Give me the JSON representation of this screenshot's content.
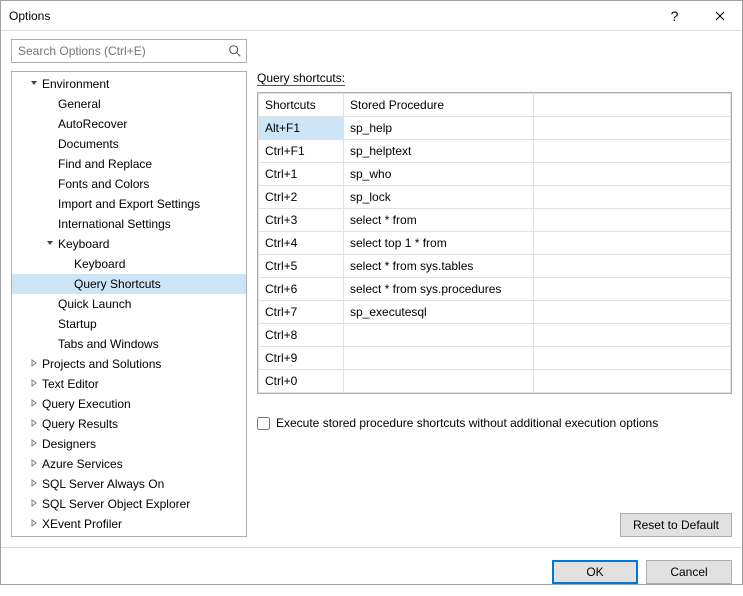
{
  "window": {
    "title": "Options"
  },
  "search": {
    "placeholder": "Search Options (Ctrl+E)"
  },
  "tree": {
    "items": [
      {
        "label": "Environment",
        "indent": 1,
        "arrow": "down",
        "selected": false
      },
      {
        "label": "General",
        "indent": 2,
        "arrow": "none",
        "selected": false
      },
      {
        "label": "AutoRecover",
        "indent": 2,
        "arrow": "none",
        "selected": false
      },
      {
        "label": "Documents",
        "indent": 2,
        "arrow": "none",
        "selected": false
      },
      {
        "label": "Find and Replace",
        "indent": 2,
        "arrow": "none",
        "selected": false
      },
      {
        "label": "Fonts and Colors",
        "indent": 2,
        "arrow": "none",
        "selected": false
      },
      {
        "label": "Import and Export Settings",
        "indent": 2,
        "arrow": "none",
        "selected": false
      },
      {
        "label": "International Settings",
        "indent": 2,
        "arrow": "none",
        "selected": false
      },
      {
        "label": "Keyboard",
        "indent": 2,
        "arrow": "down",
        "selected": false
      },
      {
        "label": "Keyboard",
        "indent": 3,
        "arrow": "none",
        "selected": false
      },
      {
        "label": "Query Shortcuts",
        "indent": 3,
        "arrow": "none",
        "selected": true
      },
      {
        "label": "Quick Launch",
        "indent": 2,
        "arrow": "none",
        "selected": false
      },
      {
        "label": "Startup",
        "indent": 2,
        "arrow": "none",
        "selected": false
      },
      {
        "label": "Tabs and Windows",
        "indent": 2,
        "arrow": "none",
        "selected": false
      },
      {
        "label": "Projects and Solutions",
        "indent": 1,
        "arrow": "right",
        "selected": false
      },
      {
        "label": "Text Editor",
        "indent": 1,
        "arrow": "right",
        "selected": false
      },
      {
        "label": "Query Execution",
        "indent": 1,
        "arrow": "right",
        "selected": false
      },
      {
        "label": "Query Results",
        "indent": 1,
        "arrow": "right",
        "selected": false
      },
      {
        "label": "Designers",
        "indent": 1,
        "arrow": "right",
        "selected": false
      },
      {
        "label": "Azure Services",
        "indent": 1,
        "arrow": "right",
        "selected": false
      },
      {
        "label": "SQL Server Always On",
        "indent": 1,
        "arrow": "right",
        "selected": false
      },
      {
        "label": "SQL Server Object Explorer",
        "indent": 1,
        "arrow": "right",
        "selected": false
      },
      {
        "label": "XEvent Profiler",
        "indent": 1,
        "arrow": "right",
        "selected": false
      }
    ]
  },
  "panel": {
    "section_label": "Query shortcuts:",
    "headers": {
      "shortcut": "Shortcuts",
      "proc": "Stored Procedure"
    },
    "rows": [
      {
        "shortcut": "Alt+F1",
        "proc": "sp_help",
        "selected": true
      },
      {
        "shortcut": "Ctrl+F1",
        "proc": "sp_helptext",
        "selected": false
      },
      {
        "shortcut": "Ctrl+1",
        "proc": "sp_who",
        "selected": false
      },
      {
        "shortcut": "Ctrl+2",
        "proc": "sp_lock",
        "selected": false
      },
      {
        "shortcut": "Ctrl+3",
        "proc": "select * from",
        "selected": false
      },
      {
        "shortcut": "Ctrl+4",
        "proc": "select top 1 * from",
        "selected": false
      },
      {
        "shortcut": "Ctrl+5",
        "proc": "select * from sys.tables",
        "selected": false
      },
      {
        "shortcut": "Ctrl+6",
        "proc": "select * from sys.procedures",
        "selected": false
      },
      {
        "shortcut": "Ctrl+7",
        "proc": "sp_executesql",
        "selected": false
      },
      {
        "shortcut": "Ctrl+8",
        "proc": "",
        "selected": false
      },
      {
        "shortcut": "Ctrl+9",
        "proc": "",
        "selected": false
      },
      {
        "shortcut": "Ctrl+0",
        "proc": "",
        "selected": false
      }
    ],
    "checkbox_label": "Execute stored procedure shortcuts without additional execution options",
    "reset_label": "Reset to Default"
  },
  "footer": {
    "ok": "OK",
    "cancel": "Cancel"
  }
}
